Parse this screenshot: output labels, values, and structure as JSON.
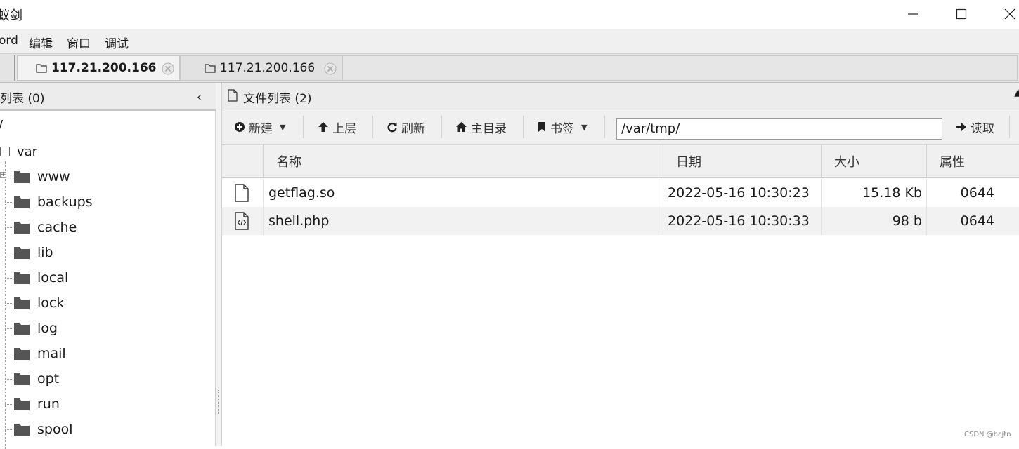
{
  "window": {
    "title": "蚁剑",
    "controls": [
      "minimize-icon",
      "maximize-icon",
      "close-icon"
    ]
  },
  "menu": {
    "items": [
      "ord",
      "编辑",
      "窗口",
      "调试"
    ]
  },
  "tabs": [
    {
      "label": "117.21.200.166",
      "active": true
    },
    {
      "label": "117.21.200.166",
      "active": false
    }
  ],
  "left_panel": {
    "title": "列表 (0)",
    "collapse": "‹",
    "root": "/",
    "var_label": "var",
    "folders": [
      "www",
      "backups",
      "cache",
      "lib",
      "local",
      "lock",
      "log",
      "mail",
      "opt",
      "run",
      "spool"
    ]
  },
  "right_panel": {
    "title": "文件列表 (2)",
    "toolbar": {
      "new": "新建",
      "up": "上层",
      "refresh": "刷新",
      "home": "主目录",
      "bookmark": "书签",
      "path": "/var/tmp/",
      "read": "读取"
    },
    "columns": [
      "名称",
      "日期",
      "大小",
      "属性"
    ],
    "files": [
      {
        "icon": "file-icon",
        "name": "getflag.so",
        "date": "2022-05-16 10:30:23",
        "size": "15.18 Kb",
        "perm": "0644"
      },
      {
        "icon": "code-file-icon",
        "name": "shell.php",
        "date": "2022-05-16 10:30:33",
        "size": "98 b",
        "perm": "0644"
      }
    ]
  },
  "watermark": "CSDN @hcjtn",
  "colors": {
    "menu_bg": "#f0f0f0",
    "header_bg": "#ececec",
    "folder": "#555555",
    "alt_row": "#f2f2f2"
  }
}
